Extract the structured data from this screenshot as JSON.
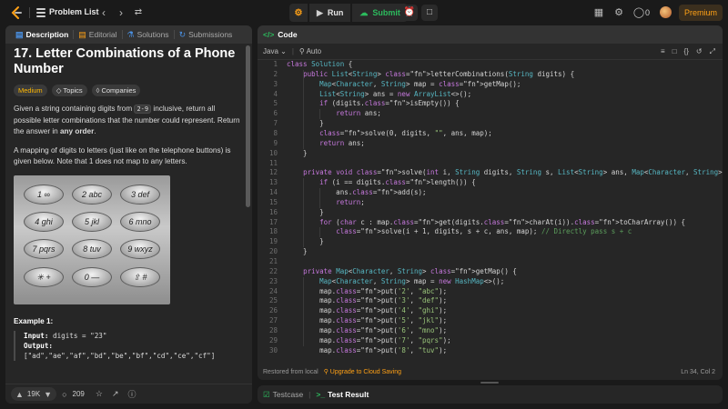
{
  "topbar": {
    "problem_list_label": "Problem List",
    "run_label": "Run",
    "submit_label": "Submit",
    "fire_count": "0",
    "premium_label": "Premium"
  },
  "left_tabs": [
    {
      "label": "Description",
      "icon": "description-icon"
    },
    {
      "label": "Editorial",
      "icon": "editorial-icon"
    },
    {
      "label": "Solutions",
      "icon": "solutions-icon"
    },
    {
      "label": "Submissions",
      "icon": "submissions-icon"
    }
  ],
  "problem": {
    "title": "17. Letter Combinations of a Phone Number",
    "difficulty": "Medium",
    "topics_label": "Topics",
    "companies_label": "Companies",
    "p1_a": "Given a string containing digits from ",
    "p1_code": "2-9",
    "p1_b": " inclusive, return all possible letter combinations that the number could represent. Return the answer in ",
    "p1_bold": "any order",
    "p1_c": ".",
    "p2": "A mapping of digits to letters (just like on the telephone buttons) is given below. Note that 1 does not map to any letters.",
    "keys": [
      "1 ∞",
      "2 abc",
      "3 def",
      "4 ghi",
      "5 jkl",
      "6 mno",
      "7 pqrs",
      "8 tuv",
      "9 wxyz",
      "✳ +",
      "0 —",
      "⇧ #"
    ],
    "example_title": "Example 1:",
    "input_label": "Input:",
    "input_value": " digits = \"23\"",
    "output_label": "Output:",
    "output_value": "[\"ad\",\"ae\",\"af\",\"bd\",\"be\",\"bf\",\"cd\",\"ce\",\"cf\"]"
  },
  "footer": {
    "likes": "19K",
    "comments": "209"
  },
  "code_panel": {
    "tab_label": "Code",
    "language": "Java",
    "auto_label": "Auto",
    "status_left": "Restored from local",
    "upgrade_label": "Upgrade to Cloud Saving",
    "cursor": "Ln 34, Col 2"
  },
  "code_lines": [
    "class Solution {",
    "    public List<String> letterCombinations(String digits) {",
    "        Map<Character, String> map = getMap();",
    "        List<String> ans = new ArrayList<>();",
    "        if (digits.isEmpty()) {",
    "            return ans;",
    "        }",
    "        solve(0, digits, \"\", ans, map);",
    "        return ans;",
    "    }",
    "",
    "    private void solve(int i, String digits, String s, List<String> ans, Map<Character, String> map) {",
    "        if (i == digits.length()) {",
    "            ans.add(s);",
    "            return;",
    "        }",
    "        for (char c : map.get(digits.charAt(i)).toCharArray()) {",
    "            solve(i + 1, digits, s + c, ans, map); // Directly pass s + c",
    "        }",
    "    }",
    "",
    "    private Map<Character, String> getMap() {",
    "        Map<Character, String> map = new HashMap<>();",
    "        map.put('2', \"abc\");",
    "        map.put('3', \"def\");",
    "        map.put('4', \"ghi\");",
    "        map.put('5', \"jkl\");",
    "        map.put('6', \"mno\");",
    "        map.put('7', \"pqrs\");",
    "        map.put('8', \"tuv\");"
  ],
  "test_panel": {
    "testcase_label": "Testcase",
    "result_label": "Test Result"
  }
}
